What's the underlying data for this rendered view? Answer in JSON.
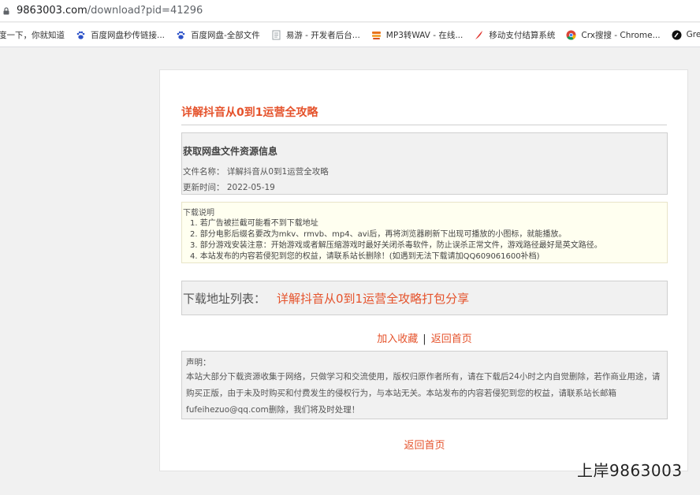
{
  "browser": {
    "url_host": "9863003.com",
    "url_path": "/download?pid=41296",
    "bookmarks": [
      {
        "label": "度一下，你就知道",
        "icon": "none"
      },
      {
        "label": "百度网盘秒传链接...",
        "icon": "baidu-paw-icon"
      },
      {
        "label": "百度网盘-全部文件",
        "icon": "baidu-paw-icon"
      },
      {
        "label": "易游 - 开发者后台...",
        "icon": "page-icon"
      },
      {
        "label": "MP3转WAV - 在线...",
        "icon": "stack-icon"
      },
      {
        "label": "移动支付结算系统",
        "icon": "feather-icon"
      },
      {
        "label": "Crx搜搜 - Chrome...",
        "icon": "chrome-icon"
      },
      {
        "label": "Greasy F",
        "icon": "greasyfork-icon"
      }
    ]
  },
  "page": {
    "title": "详解抖音从0到1运营全攻略",
    "info": {
      "heading": "获取网盘文件资源信息",
      "filename_label": "文件名称：",
      "filename": "详解抖音从0到1运营全攻略",
      "updated_label": "更新时间：",
      "updated": "2022-05-19"
    },
    "notes": {
      "heading": "下载说明",
      "items": [
        "1. 若广告被拦截可能看不到下载地址",
        "2. 部分电影后缀名要改为mkv、rmvb、mp4、avi后，再将浏览器刷新下出现可播放的小图标，就能播放。",
        "3. 部分游戏安装注意：开始游戏或者解压缩游戏时最好关闭杀毒软件，防止误杀正常文件，游戏路径最好是英文路径。",
        "4. 本站发布的内容若侵犯到您的权益，请联系站长删除！(如遇到无法下载请加QQ609061600补档)"
      ]
    },
    "download": {
      "label": "下载地址列表：",
      "link": "详解抖音从0到1运营全攻略打包分享"
    },
    "links": {
      "favorite": "加入收藏",
      "separator": "|",
      "home": "返回首页"
    },
    "disclaimer": {
      "heading": "声明：",
      "body": "本站大部分下载资源收集于网络，只做学习和交流使用，版权归原作者所有，请在下载后24小时之内自觉删除，若作商业用途，请购买正版，由于未及时购买和付费发生的侵权行为，与本站无关。本站发布的内容若侵犯到您的权益，请联系站长邮箱fufeihezuo@qq.com删除，我们将及时处理！"
    },
    "bottom_home": "返回首页"
  },
  "watermark": "上岸9863003",
  "colors": {
    "accent": "#e5522b",
    "panel": "#f1f1f1",
    "notes_bg": "#fffff0"
  }
}
